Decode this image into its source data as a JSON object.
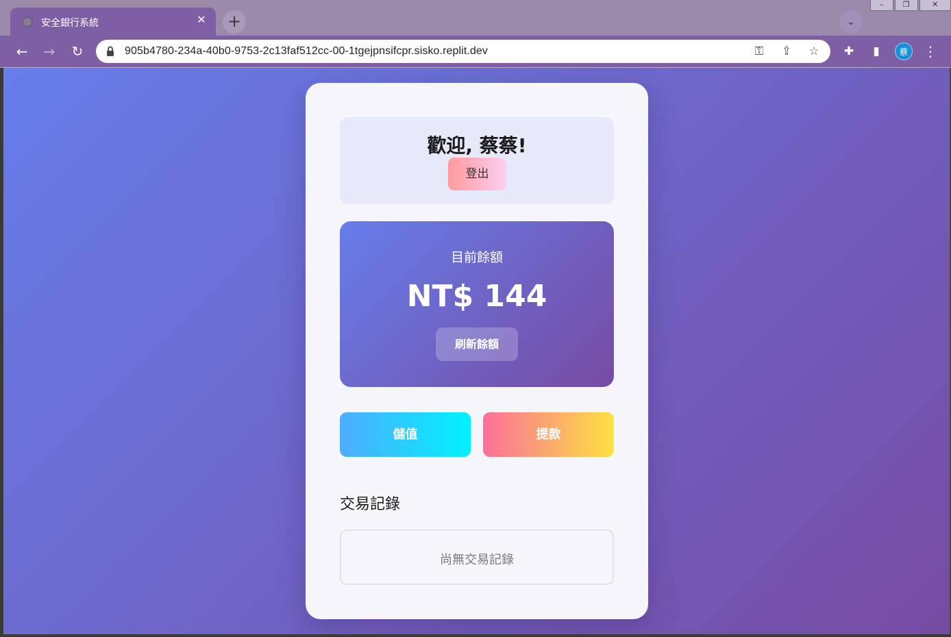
{
  "browser": {
    "tab_title": "安全銀行系統",
    "tab_close": "✕",
    "new_tab": "+",
    "tab_search": "⌄",
    "url": "905b4780-234a-40b0-9753-2c13faf512cc-00-1tgejpnsifcpr.sisko.replit.dev",
    "profile_initial": "蔡",
    "window_controls": {
      "minimize": "–",
      "maximize": "❐",
      "close": "✕"
    },
    "icons": {
      "back": "←",
      "forward": "→",
      "reload": "↻",
      "key": "⚿",
      "share": "⇪",
      "star": "☆",
      "extensions": "✚",
      "sidepanel": "▮",
      "menu": "⋮"
    }
  },
  "app": {
    "welcome": "歡迎, 蔡蔡!",
    "logout_label": "登出",
    "balance_label": "目前餘額",
    "balance_amount": "NT$ 144",
    "refresh_label": "刷新餘額",
    "deposit_label": "儲值",
    "withdraw_label": "提款",
    "history_title": "交易記錄",
    "history_empty": "尚無交易記錄"
  }
}
